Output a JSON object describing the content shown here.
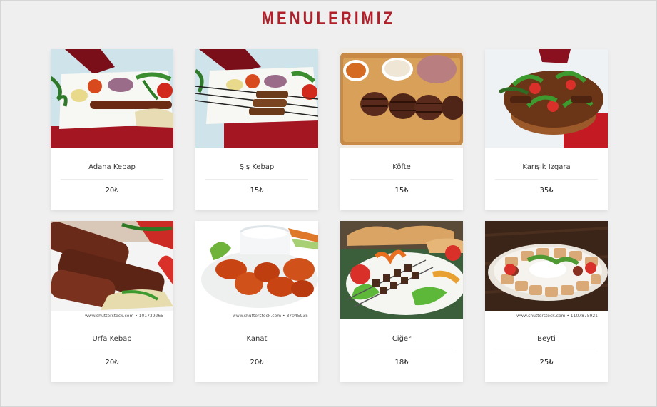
{
  "page": {
    "title": "MENULERIMIZ"
  },
  "menu_items": [
    {
      "name": "Adana Kebap",
      "price": "20₺",
      "image": "adana-kebap-photo"
    },
    {
      "name": "Şiş Kebap",
      "price": "15₺",
      "image": "sis-kebap-photo"
    },
    {
      "name": "Köfte",
      "price": "15₺",
      "image": "kofte-photo"
    },
    {
      "name": "Karışık Izgara",
      "price": "35₺",
      "image": "karisik-izgara-photo"
    },
    {
      "name": "Urfa Kebap",
      "price": "20₺",
      "image": "urfa-kebap-photo",
      "watermark": "www.shutterstock.com • 101739265"
    },
    {
      "name": "Kanat",
      "price": "20₺",
      "image": "kanat-photo",
      "watermark": "www.shutterstock.com • 87045935"
    },
    {
      "name": "Ciğer",
      "price": "18₺",
      "image": "ciger-photo"
    },
    {
      "name": "Beyti",
      "price": "25₺",
      "image": "beyti-photo",
      "watermark": "www.shutterstock.com • 1107875921"
    }
  ]
}
